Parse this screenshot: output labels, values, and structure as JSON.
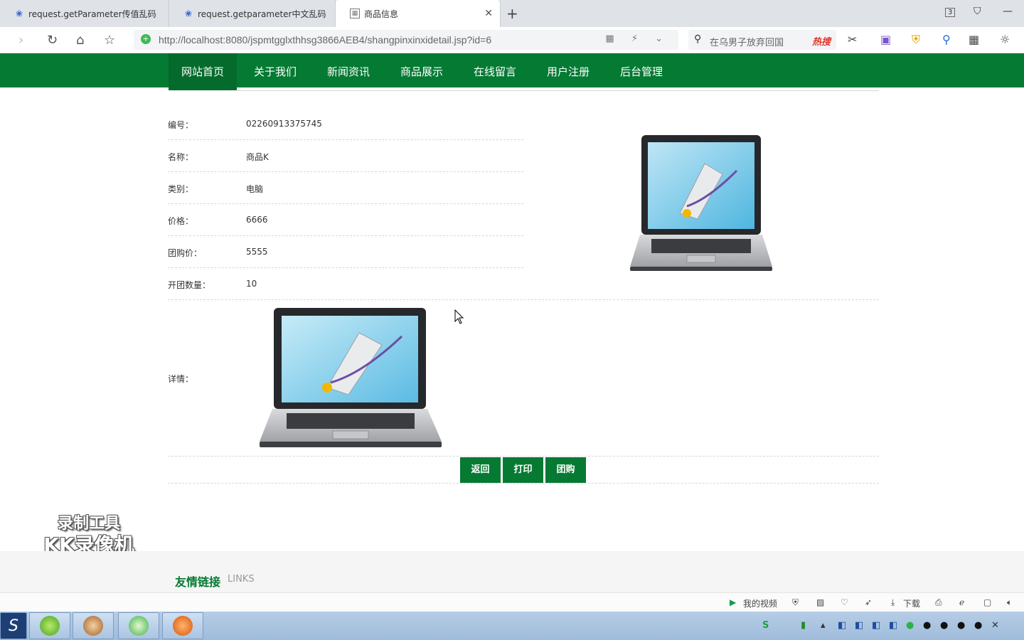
{
  "browser": {
    "tabs": [
      {
        "title": "request.getParameter传值乱码"
      },
      {
        "title": "request.getparameter中文乱码"
      },
      {
        "title": "商品信息"
      }
    ],
    "tab_count": "3",
    "url": "http://localhost:8080/jspmtgglxthhsg3866AEB4/shangpinxinxidetail.jsp?id=6",
    "search_text": "在乌男子放弃回国",
    "hot_label": "热搜"
  },
  "nav": {
    "items": [
      "网站首页",
      "关于我们",
      "新闻资讯",
      "商品展示",
      "在线留言",
      "用户注册",
      "后台管理"
    ]
  },
  "product": {
    "fields": [
      {
        "label": "编号：",
        "value": "02260913375745"
      },
      {
        "label": "名称：",
        "value": "商品K"
      },
      {
        "label": "类别：",
        "value": "电脑"
      },
      {
        "label": "价格：",
        "value": "6666"
      },
      {
        "label": "团购价：",
        "value": "5555"
      },
      {
        "label": "开团数量：",
        "value": "10"
      }
    ],
    "detail_label": "详情："
  },
  "buttons": {
    "back": "返回",
    "print": "打印",
    "groupbuy": "团购"
  },
  "footer": {
    "title": "友情链接",
    "subtitle": "LINKS"
  },
  "watermark": {
    "line1": "录制工具",
    "line2": "KK录像机"
  },
  "statusbar": {
    "my_video": "我的视频",
    "download": "下载"
  },
  "colors": {
    "brand_green": "#047a33",
    "button_green": "#067a33"
  }
}
